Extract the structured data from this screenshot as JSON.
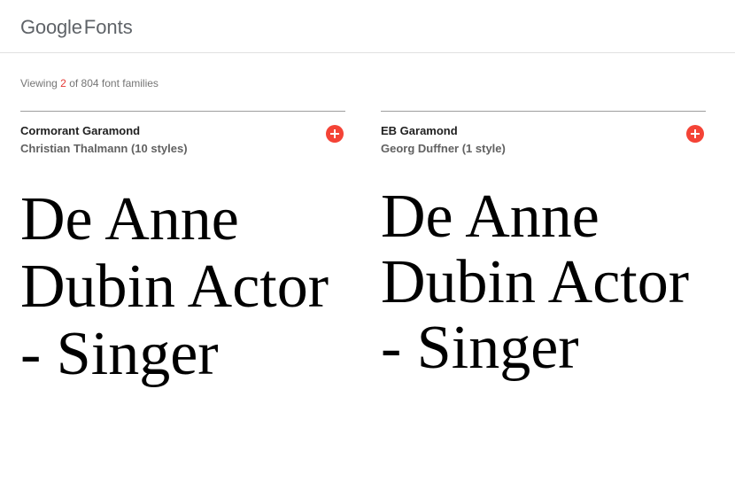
{
  "header": {
    "logo_google": "Google",
    "logo_fonts": "Fonts"
  },
  "summary": {
    "prefix": "Viewing",
    "count": "2",
    "suffix": "of 804 font families"
  },
  "colors": {
    "accent": "#f44336",
    "highlight_count": "#e53935"
  },
  "cards": [
    {
      "name": "Cormorant Garamond",
      "meta": "Christian Thalmann (10 styles)",
      "sample": "De Anne Dubin Actor - Singer",
      "add_icon": "plus-circle-icon"
    },
    {
      "name": "EB Garamond",
      "meta": "Georg Duffner (1 style)",
      "sample": "De Anne Dubin Actor - Singer",
      "add_icon": "plus-circle-icon"
    }
  ]
}
